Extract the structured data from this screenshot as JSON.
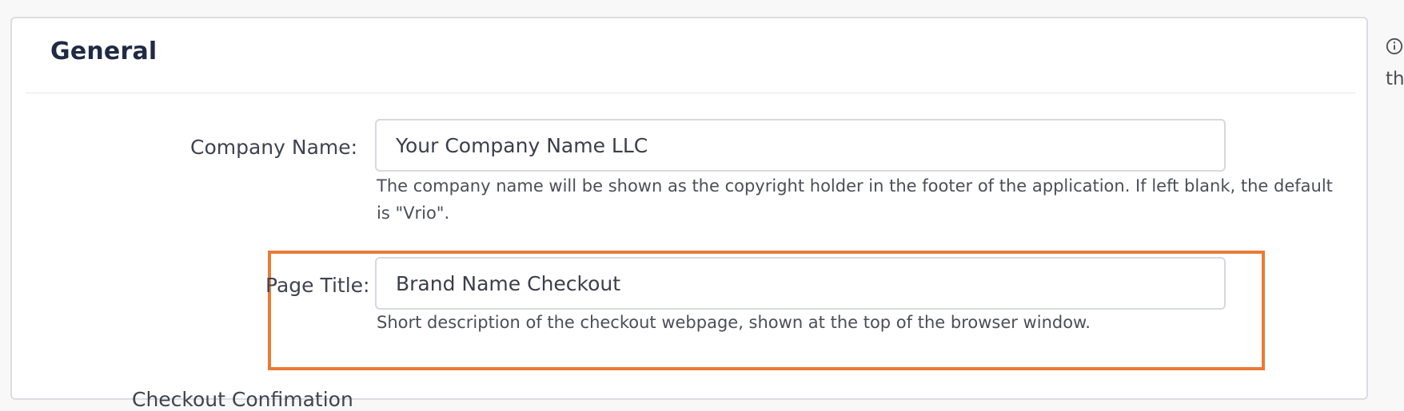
{
  "general": {
    "title": "General"
  },
  "company_name": {
    "label": "Company Name:",
    "value": "Your Company Name LLC",
    "help": "The company name will be shown as the copyright holder in the footer of the application. If left blank, the default is \"Vrio\"."
  },
  "page_title": {
    "label": "Page Title:",
    "value": "Brand Name Checkout",
    "help": "Short description of the checkout webpage, shown at the top of the browser window."
  },
  "checkout_confirmation": {
    "label": "Checkout Confimation"
  },
  "side_panel": {
    "icon": "info-icon",
    "text": "th"
  },
  "colors": {
    "highlight": "#e97b36",
    "title": "#1f2a44"
  }
}
